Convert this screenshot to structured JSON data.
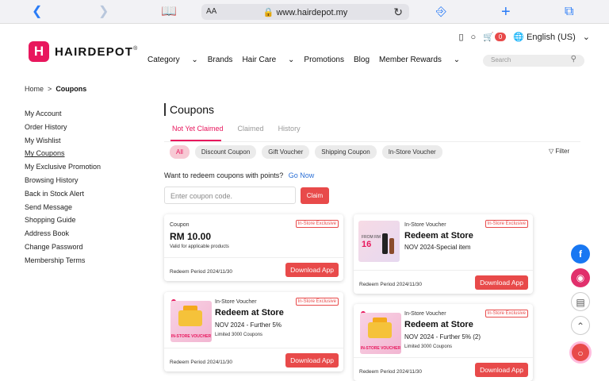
{
  "browser": {
    "aa_label": "AA",
    "url": "www.hairdepot.my",
    "icons": [
      "back-icon",
      "forward-icon",
      "book-icon",
      "reload-icon",
      "share-icon",
      "plus-icon",
      "tabs-icon"
    ]
  },
  "header": {
    "logo_letter": "H",
    "logo_text": "HAIRDEPOT",
    "logo_mark": "®",
    "cart_count": "0",
    "language": "English (US)",
    "search_placeholder": "Search",
    "nav": [
      "Category",
      "Brands",
      "Hair Care",
      "Promotions",
      "Blog",
      "Member Rewards"
    ]
  },
  "breadcrumb": {
    "home": "Home",
    "sep": ">",
    "current": "Coupons"
  },
  "sidebar": [
    "My Account",
    "Order History",
    "My Wishlist",
    "My Coupons",
    "My Exclusive Promotion",
    "Browsing History",
    "Back in Stock Alert",
    "Send Message",
    "Shopping Guide",
    "Address Book",
    "Change Password",
    "Membership Terms"
  ],
  "main": {
    "title": "Coupons",
    "tabs": [
      "Not Yet Claimed",
      "Claimed",
      "History"
    ],
    "chips": [
      "All",
      "Discount Coupon",
      "Gift Voucher",
      "Shipping Coupon",
      "In-Store Voucher"
    ],
    "filter": "Filter",
    "redeem_text": "Want to redeem coupons with points?",
    "redeem_link": "Go Now",
    "coupon_placeholder": "Enter coupon code.",
    "claim": "Claim"
  },
  "cards": [
    {
      "type": "Coupon",
      "title": "RM 10.00",
      "sub": "Valid for applicable products",
      "badge": "In-Store Exclusive",
      "period": "Redeem Period 2024/11/30",
      "button": "Download App"
    },
    {
      "type": "In-Store Voucher",
      "title": "Redeem at Store",
      "sub": "NOV 2024-Special item",
      "badge": "In-Store Exclusive",
      "period": "Redeem Period 2024/11/30",
      "button": "Download App",
      "thumb_small": "FROM RM",
      "thumb_big": "16"
    },
    {
      "type": "In-Store Voucher",
      "title": "Redeem at Store",
      "sub": "NOV 2024 - Further 5%",
      "limit": "Limited 3000 Coupons",
      "badge": "In-Store Exclusive",
      "period": "Redeem Period 2024/11/30",
      "button": "Download App",
      "thumb_label": "IN-STORE VOUCHER"
    },
    {
      "type": "In-Store Voucher",
      "title": "Redeem at Store",
      "sub": "NOV 2024 - Further 5% (2)",
      "limit": "Limited 3000 Coupons",
      "badge": "In-Store Exclusive",
      "period": "Redeem Period 2024/11/30",
      "button": "Download App",
      "thumb_label": "IN-STORE VOUCHER"
    }
  ],
  "colors": {
    "accent": "#e8175d",
    "button": "#e84a4a",
    "link": "#2a6fd6",
    "facebook": "#1877f2",
    "instagram": "#e1306c"
  }
}
